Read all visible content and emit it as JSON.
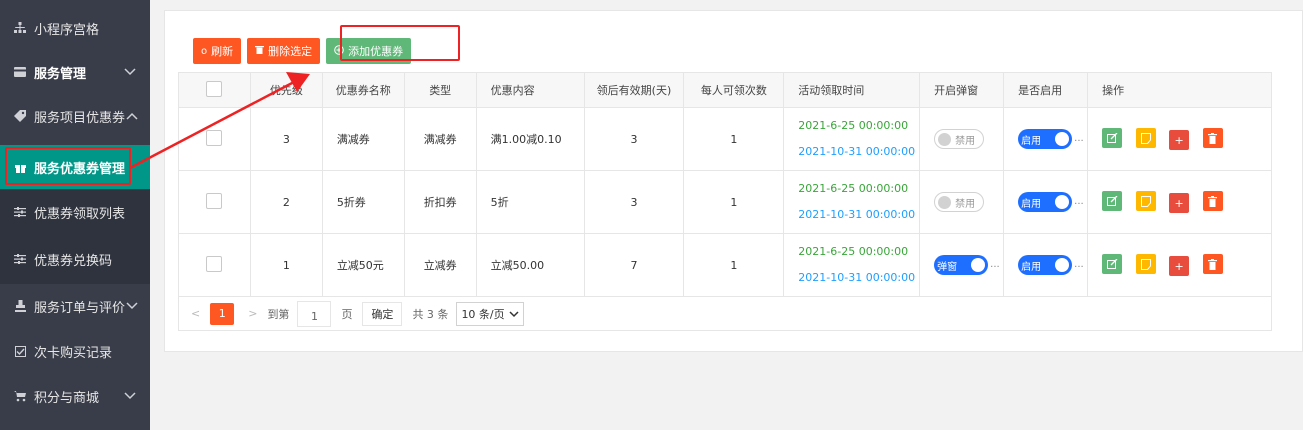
{
  "sidebar": {
    "items": [
      {
        "label": "小程序宫格",
        "icon": "sitemap-icon"
      },
      {
        "label": "服务管理",
        "icon": "card-icon"
      },
      {
        "label": "服务项目优惠券",
        "icon": "tag-icon"
      },
      {
        "label": "服务优惠券管理",
        "icon": "gift-icon"
      },
      {
        "label": "优惠券领取列表",
        "icon": "sliders-icon"
      },
      {
        "label": "优惠券兑换码",
        "icon": "sliders-icon"
      },
      {
        "label": "服务订单与评价",
        "icon": "stamp-icon"
      },
      {
        "label": "次卡购买记录",
        "icon": "checkbox-icon"
      },
      {
        "label": "积分与商城",
        "icon": "cart-icon"
      }
    ]
  },
  "toolbar": {
    "refresh": "刷新",
    "delete_selected": "删除选定",
    "add_coupon": "添加优惠券"
  },
  "table": {
    "headers": [
      "",
      "优先级",
      "优惠券名称",
      "类型",
      "优惠内容",
      "领后有效期(天)",
      "每人可领次数",
      "活动领取时间",
      "开启弹窗",
      "是否启用",
      "操作"
    ],
    "rows": [
      {
        "priority": "3",
        "name": "满减券",
        "type": "满减券",
        "content": "满1.00减0.10",
        "valid_days": "3",
        "per_person": "1",
        "start": "2021-6-25 00:00:00",
        "end": "2021-10-31 00:00:00",
        "popup": "禁用",
        "popup_on": false,
        "enabled": "启用",
        "enabled_on": true
      },
      {
        "priority": "2",
        "name": "5折券",
        "type": "折扣券",
        "content": "5折",
        "valid_days": "3",
        "per_person": "1",
        "start": "2021-6-25 00:00:00",
        "end": "2021-10-31 00:00:00",
        "popup": "禁用",
        "popup_on": false,
        "enabled": "启用",
        "enabled_on": true
      },
      {
        "priority": "1",
        "name": "立减50元",
        "type": "立减券",
        "content": "立减50.00",
        "valid_days": "7",
        "per_person": "1",
        "start": "2021-6-25 00:00:00",
        "end": "2021-10-31 00:00:00",
        "popup": "弹窗",
        "popup_on": true,
        "enabled": "启用",
        "enabled_on": true
      }
    ]
  },
  "pager": {
    "current": "1",
    "goto": "到第",
    "page_input": "1",
    "page_unit": "页",
    "confirm": "确定",
    "total": "共 3 条",
    "per_page": "10 条/页"
  },
  "colors": {
    "sidebar_bg": "#393d49",
    "active": "#009688",
    "orange": "#ff5722",
    "green": "#5fb878",
    "blue": "#1e6fff",
    "annotation_red": "#ee2222"
  }
}
